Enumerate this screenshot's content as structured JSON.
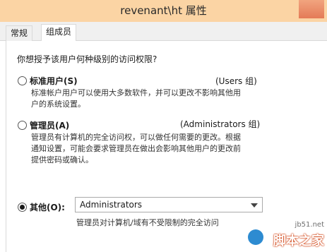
{
  "window": {
    "title": "revenant\\ht 属性"
  },
  "tabs": [
    {
      "label": "常规"
    },
    {
      "label": "组成员"
    }
  ],
  "question": "你想授予该用户何种级别的访问权限?",
  "options": [
    {
      "label": "标准用户(S)",
      "group": "(Users 组)",
      "desc_lines": [
        "标准帐户用户可以使用大多数软件，并可以更改不影响其他用",
        "户的系统设置。"
      ],
      "checked": false
    },
    {
      "label": "管理员(A)",
      "group": "(Administrators 组)",
      "desc_lines": [
        "管理员有计算机的完全访问权，可以做任何需要的更改。根据",
        "通知设置，可能会要求管理员在做出会影响其他用户的更改前",
        "提供密码或确认。"
      ],
      "checked": false
    },
    {
      "label": "其他(O):",
      "checked": true
    }
  ],
  "other_select": {
    "value": "Administrators"
  },
  "other_note": "管理员对计算机/域有不受限制的完全访问",
  "watermark": {
    "url": "jb51.net",
    "name": "脚本之家"
  },
  "colors": {
    "titlebar": "#fbd4a4",
    "close": "#e47b57"
  }
}
